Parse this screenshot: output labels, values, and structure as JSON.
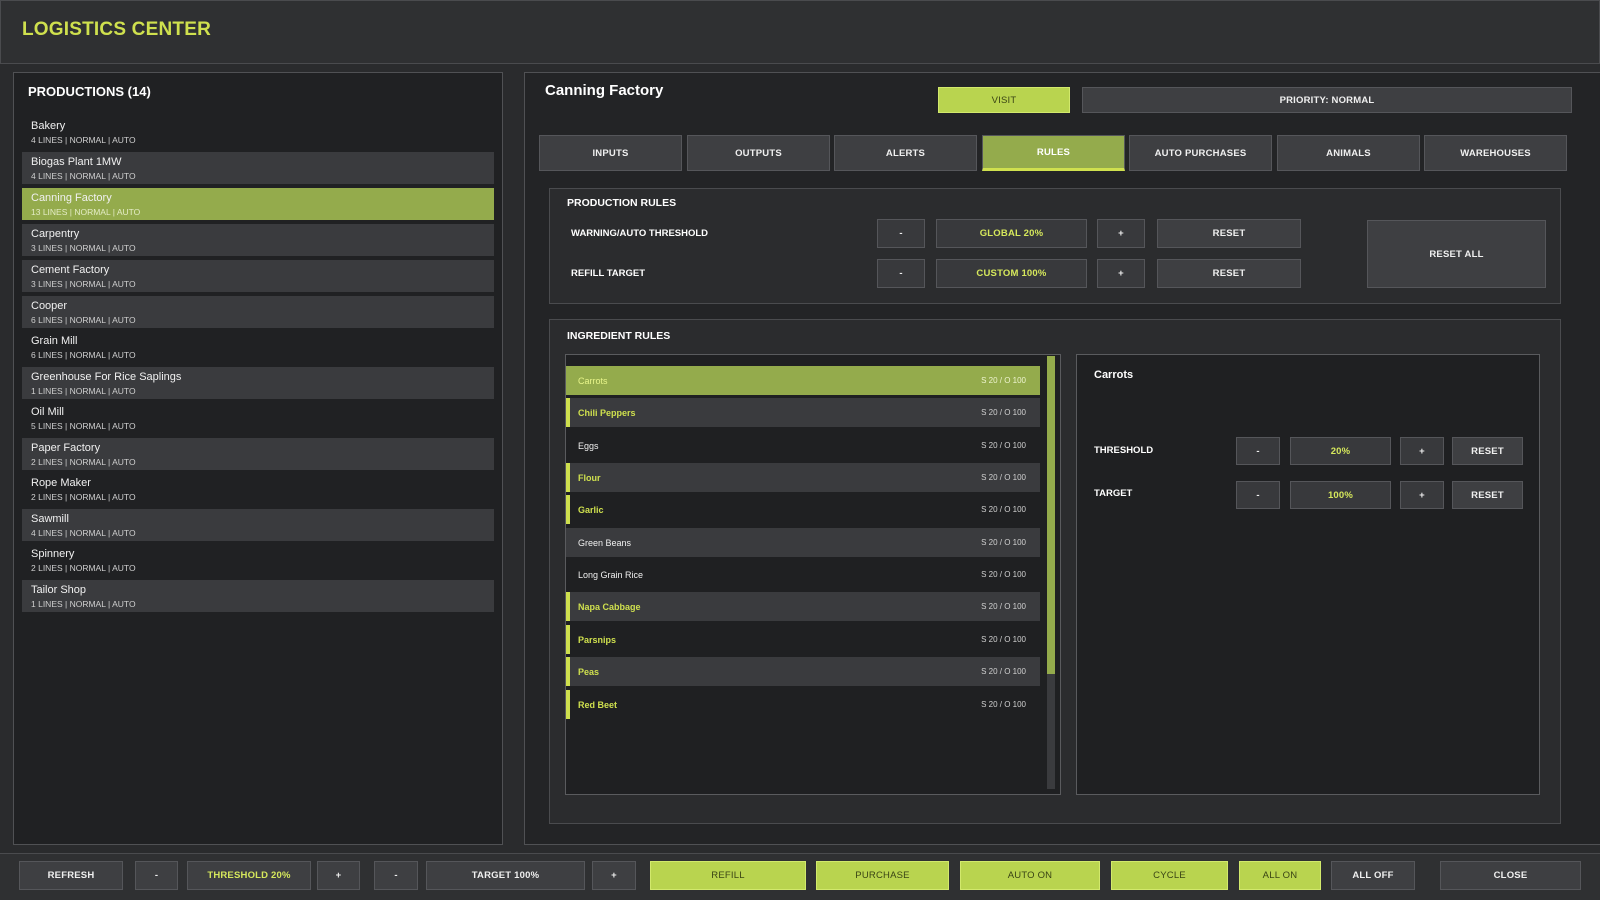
{
  "app": {
    "title": "LOGISTICS CENTER"
  },
  "productions": {
    "heading": "PRODUCTIONS (14)",
    "items": [
      {
        "name": "Bakery",
        "meta": "4 LINES | NORMAL | AUTO"
      },
      {
        "name": "Biogas Plant 1MW",
        "meta": "4 LINES | NORMAL | AUTO"
      },
      {
        "name": "Canning Factory",
        "meta": "13 LINES | NORMAL | AUTO"
      },
      {
        "name": "Carpentry",
        "meta": "3 LINES | NORMAL | AUTO"
      },
      {
        "name": "Cement Factory",
        "meta": "3 LINES | NORMAL | AUTO"
      },
      {
        "name": "Cooper",
        "meta": "6 LINES | NORMAL | AUTO"
      },
      {
        "name": "Grain Mill",
        "meta": "6 LINES | NORMAL | AUTO"
      },
      {
        "name": "Greenhouse For Rice Saplings",
        "meta": "1 LINES | NORMAL | AUTO"
      },
      {
        "name": "Oil Mill",
        "meta": "5 LINES | NORMAL | AUTO"
      },
      {
        "name": "Paper Factory",
        "meta": "2 LINES | NORMAL | AUTO"
      },
      {
        "name": "Rope Maker",
        "meta": "2 LINES | NORMAL | AUTO"
      },
      {
        "name": "Sawmill",
        "meta": "4 LINES | NORMAL | AUTO"
      },
      {
        "name": "Spinnery",
        "meta": "2 LINES | NORMAL | AUTO"
      },
      {
        "name": "Tailor Shop",
        "meta": "1 LINES | NORMAL | AUTO"
      }
    ],
    "selected": "Canning Factory"
  },
  "detail": {
    "title": "Canning Factory",
    "visit_label": "VISIT",
    "priority_label": "PRIORITY: NORMAL",
    "tabs": [
      "INPUTS",
      "OUTPUTS",
      "ALERTS",
      "RULES",
      "AUTO PURCHASES",
      "ANIMALS",
      "WAREHOUSES"
    ],
    "active_tab": "RULES"
  },
  "production_rules": {
    "heading": "PRODUCTION RULES",
    "minus": "-",
    "plus": "+",
    "reset": "RESET",
    "reset_all": "RESET ALL",
    "threshold": {
      "label": "WARNING/AUTO THRESHOLD",
      "value": "GLOBAL 20%"
    },
    "refill": {
      "label": "REFILL TARGET",
      "value": "CUSTOM 100%"
    }
  },
  "ingredient_rules": {
    "heading": "INGREDIENT RULES",
    "items": [
      {
        "name": "Carrots",
        "stat": "S 20 / O 100"
      },
      {
        "name": "Chili Peppers",
        "stat": "S 20 / O 100"
      },
      {
        "name": "Eggs",
        "stat": "S 20 / O 100"
      },
      {
        "name": "Flour",
        "stat": "S 20 / O 100"
      },
      {
        "name": "Garlic",
        "stat": "S 20 / O 100"
      },
      {
        "name": "Green Beans",
        "stat": "S 20 / O 100"
      },
      {
        "name": "Long Grain Rice",
        "stat": "S 20 / O 100"
      },
      {
        "name": "Napa Cabbage",
        "stat": "S 20 / O 100"
      },
      {
        "name": "Parsnips",
        "stat": "S 20 / O 100"
      },
      {
        "name": "Peas",
        "stat": "S 20 / O 100"
      },
      {
        "name": "Red Beet",
        "stat": "S 20 / O 100"
      }
    ],
    "selected": {
      "name": "Carrots",
      "threshold_label": "THRESHOLD",
      "threshold_value": "20%",
      "target_label": "TARGET",
      "target_value": "100%"
    }
  },
  "bottom_bar": {
    "refresh": "REFRESH",
    "minus": "-",
    "plus": "+",
    "threshold": "THRESHOLD 20%",
    "target": "TARGET 100%",
    "refill": "REFILL",
    "purchase": "PURCHASE",
    "auto_on": "AUTO ON",
    "cycle": "CYCLE",
    "all_on": "ALL ON",
    "all_off": "ALL OFF",
    "close": "CLOSE"
  },
  "colors": {
    "accent": "#cfe04e",
    "selected_bg": "#94ab4c",
    "button_green": "#b9d44f",
    "panel_bg": "#202123"
  }
}
